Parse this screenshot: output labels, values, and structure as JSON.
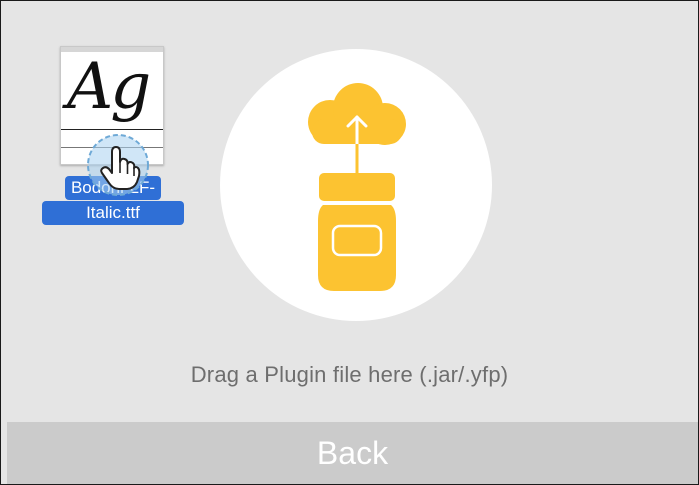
{
  "drop_zone": {
    "instruction": "Drag a Plugin file here (.jar/.yfp)",
    "icon": "jar-cloud-upload-icon"
  },
  "footer": {
    "back_label": "Back"
  },
  "dragged_file": {
    "thumbnail_glyph": "Ag",
    "name_line1": "Bodoni-LF-",
    "name_line2": "Italic.ttf"
  },
  "colors": {
    "background": "#e5e5e5",
    "accent": "#fcc331",
    "selection": "#2f6fd6",
    "back_bar": "#cbcbcb"
  }
}
